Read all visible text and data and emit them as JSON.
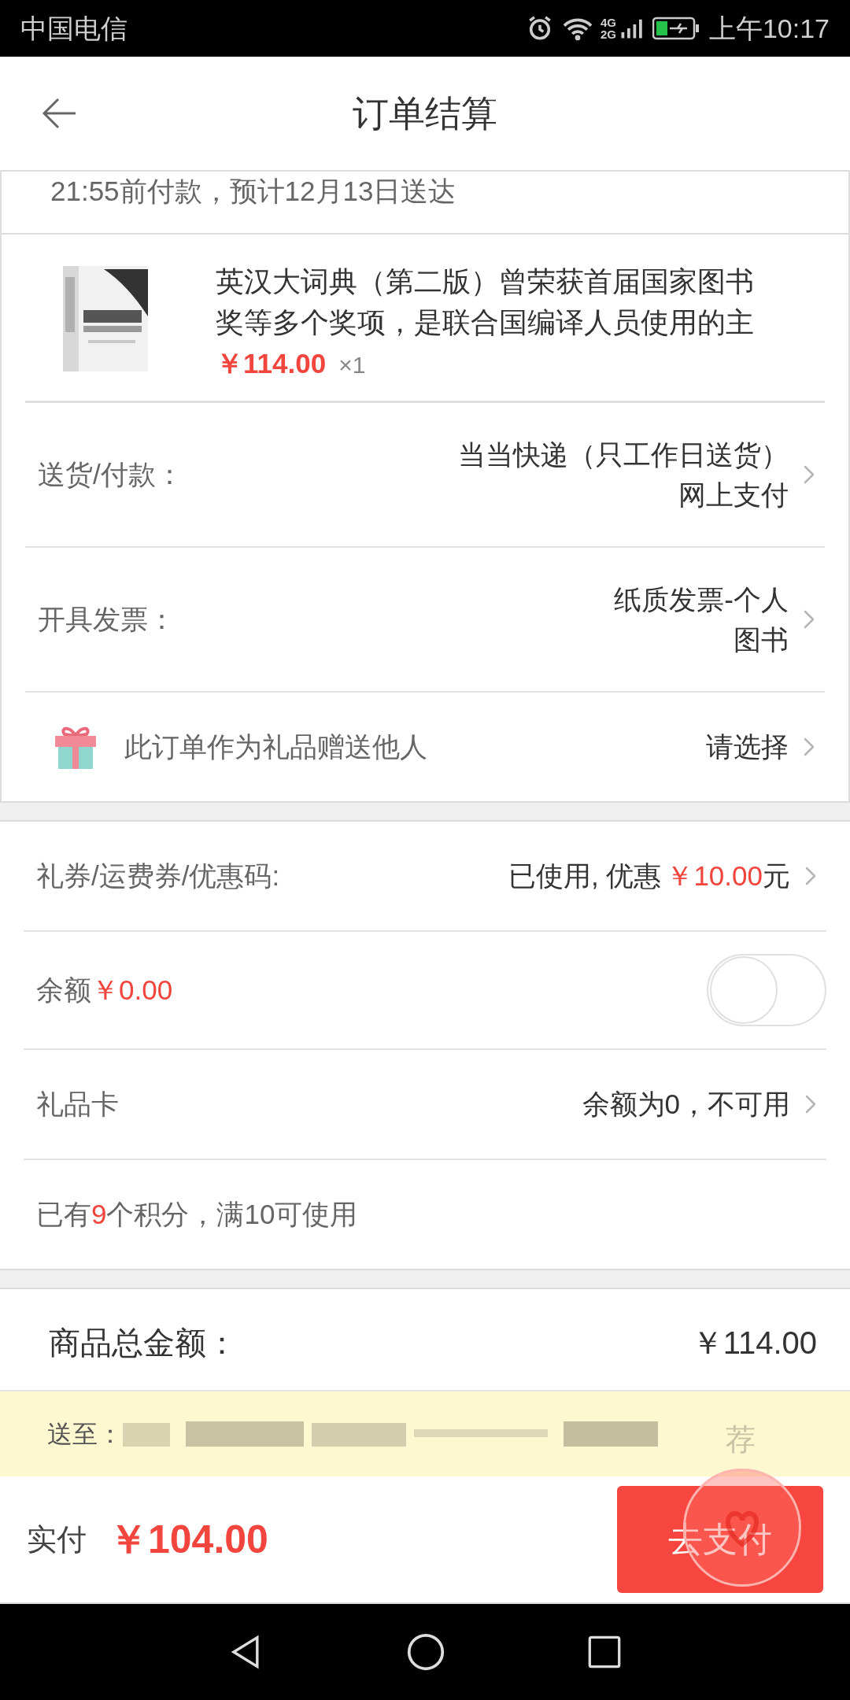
{
  "status_bar": {
    "carrier": "中国电信",
    "net_top": "4G",
    "net_bottom": "2G",
    "time": "上午10:17"
  },
  "header": {
    "title": "订单结算"
  },
  "delivery_notice": "21:55前付款，预计12月13日送达",
  "product": {
    "title": "英汉大词典（第二版）曾荣获首届国家图书奖等多个奖项，是联合国编译人员使用的主",
    "price": "￥114.00",
    "quantity": "×1"
  },
  "order_rows": [
    {
      "kind": "detail",
      "label": "送货/付款：",
      "values": [
        "当当快递（只工作日送货）",
        "网上支付"
      ]
    },
    {
      "kind": "detail",
      "label": "开具发票：",
      "values": [
        "纸质发票-个人",
        "图书"
      ]
    },
    {
      "kind": "gift",
      "label": "此订单作为礼品赠送他人",
      "values": [
        "请选择"
      ]
    }
  ],
  "payment_rows": [
    {
      "kind": "link",
      "label": "礼券/运费券/优惠码:",
      "value_prefix": "已使用, 优惠",
      "value_amount": "￥10.00",
      "value_suffix": "元"
    },
    {
      "kind": "toggle",
      "label": "余额",
      "value_amount": "￥0.00",
      "on": false
    },
    {
      "kind": "link",
      "label": "礼品卡",
      "value_prefix": "余额为0，不可用"
    },
    {
      "kind": "note",
      "label": "已有**9**个积分，满10可使用"
    }
  ],
  "summary": {
    "label": "商品总金额：",
    "value": "￥114.00"
  },
  "address_bar": {
    "label": "送至："
  },
  "footer": {
    "label": "实付",
    "amount": "￥104.00",
    "button": "去支付"
  },
  "floating_badge": {
    "text": "荐"
  }
}
